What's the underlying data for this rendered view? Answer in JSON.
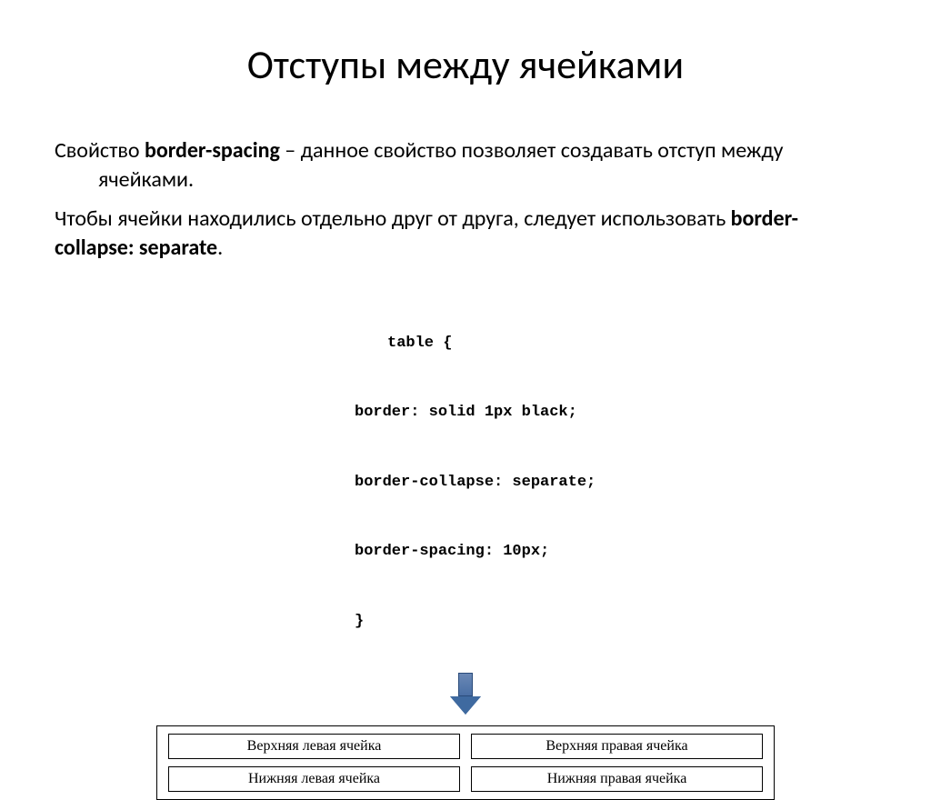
{
  "title": "Отступы между ячейками",
  "para1_pre": "Свойство ",
  "para1_bold": "border-spacing",
  "para1_post": " – данное свойство позволяет создавать отступ между ячейками.",
  "para2_pre": "Чтобы ячейки находились отдельно друг от друга, следует использовать ",
  "para2_bold": "border-collapse: separate",
  "para2_post": ".",
  "code": {
    "l1": "table {",
    "l2": "border: solid 1px black;",
    "l3": "border-collapse: separate;",
    "l4": "border-spacing: 10px;",
    "l5": "}"
  },
  "cells": {
    "tl": "Верхняя левая ячейка",
    "tr": "Верхняя правая ячейка",
    "bl": "Нижняя левая ячейка",
    "br": "Нижняя правая ячейка"
  }
}
